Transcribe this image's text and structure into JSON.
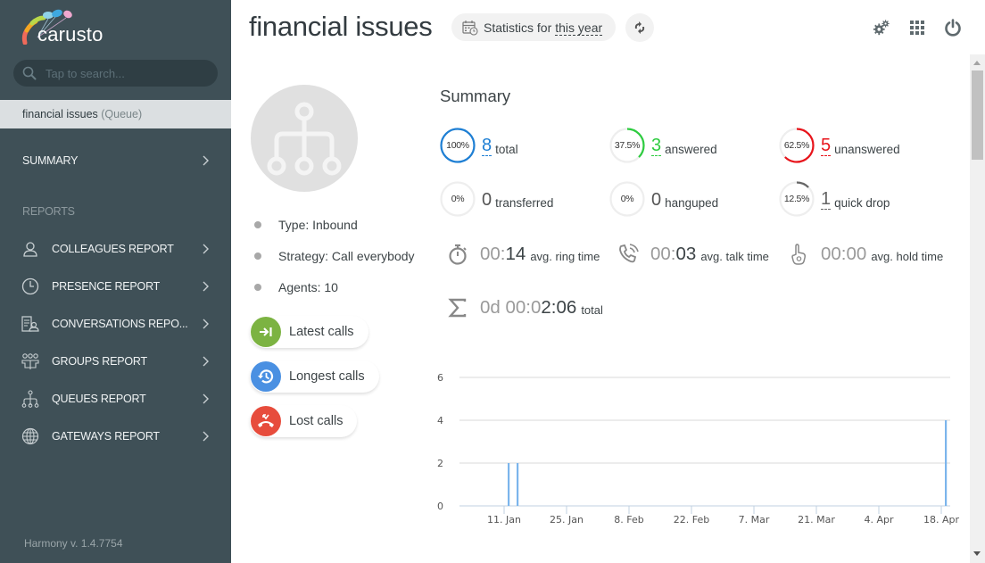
{
  "app": {
    "logo_text": "carusto",
    "version": "Harmony v. 1.4.7754"
  },
  "sidebar": {
    "search_placeholder": "Tap to search...",
    "current": {
      "name": "financial issues",
      "type": "(Queue)"
    },
    "summary_label": "SUMMARY",
    "section_label": "REPORTS",
    "items": [
      {
        "label": "COLLEAGUES REPORT",
        "icon": "person-icon"
      },
      {
        "label": "PRESENCE REPORT",
        "icon": "clock-icon"
      },
      {
        "label": "CONVERSATIONS REPO...",
        "icon": "conversation-report-icon"
      },
      {
        "label": "GROUPS REPORT",
        "icon": "group-icon"
      },
      {
        "label": "QUEUES REPORT",
        "icon": "queue-tree-icon"
      },
      {
        "label": "GATEWAYS REPORT",
        "icon": "globe-icon"
      }
    ]
  },
  "header": {
    "title": "financial issues",
    "stats_prefix": "Statistics for",
    "stats_period": "this year"
  },
  "queue": {
    "info": [
      "Type: Inbound",
      "Strategy: Call everybody",
      "Agents: 10"
    ],
    "actions": [
      {
        "label": "Latest calls",
        "color": "#7cb342"
      },
      {
        "label": "Longest calls",
        "color": "#4a90e2"
      },
      {
        "label": "Lost calls",
        "color": "#e74c3c"
      }
    ]
  },
  "summary": {
    "title": "Summary",
    "stats": [
      {
        "pct": "100%",
        "fraction": 1.0,
        "value": "8",
        "label": "total",
        "color": "#1e7fd4"
      },
      {
        "pct": "37.5%",
        "fraction": 0.375,
        "value": "3",
        "label": "answered",
        "color": "#2ecc40"
      },
      {
        "pct": "62.5%",
        "fraction": 0.625,
        "value": "5",
        "label": "unanswered",
        "color": "#e8141b"
      },
      {
        "pct": "0%",
        "fraction": 0,
        "value": "0",
        "label": "transferred",
        "color": "#555555"
      },
      {
        "pct": "0%",
        "fraction": 0,
        "value": "0",
        "label": "hanguped",
        "color": "#555555"
      },
      {
        "pct": "12.5%",
        "fraction": 0.125,
        "value": "1",
        "label": "quick drop",
        "color": "#666666"
      }
    ],
    "times": [
      {
        "dim": "00:",
        "strong": "14",
        "label": "avg. ring time",
        "icon": "stopwatch-icon"
      },
      {
        "dim": "00:",
        "strong": "03",
        "label": "avg. talk time",
        "icon": "phone-talk-icon"
      },
      {
        "dim": "00:00",
        "strong": "",
        "label": "avg. hold time",
        "icon": "hold-hand-icon"
      },
      {
        "dim": "0d 00:0",
        "strong": "2:06",
        "label": "total",
        "icon": "sigma-icon"
      }
    ]
  },
  "chart_data": {
    "type": "bar",
    "title": "",
    "xlabel": "",
    "ylabel": "",
    "ylim": [
      0,
      6
    ],
    "yticks": [
      0,
      2,
      4,
      6
    ],
    "grid": true,
    "x_ticks": [
      "11. Jan",
      "25. Jan",
      "8. Feb",
      "22. Feb",
      "7. Mar",
      "21. Mar",
      "4. Apr",
      "18. Apr"
    ],
    "x_range_days": [
      0,
      110
    ],
    "x_tick_days": [
      10,
      24,
      38,
      52,
      66,
      80,
      94,
      108
    ],
    "bars": [
      {
        "day": 11,
        "date": "12. Jan",
        "value": 2
      },
      {
        "day": 13,
        "date": "14. Jan",
        "value": 2
      },
      {
        "day": 109,
        "date": "19. Apr",
        "value": 4
      }
    ],
    "color": "#7cb5ec"
  }
}
